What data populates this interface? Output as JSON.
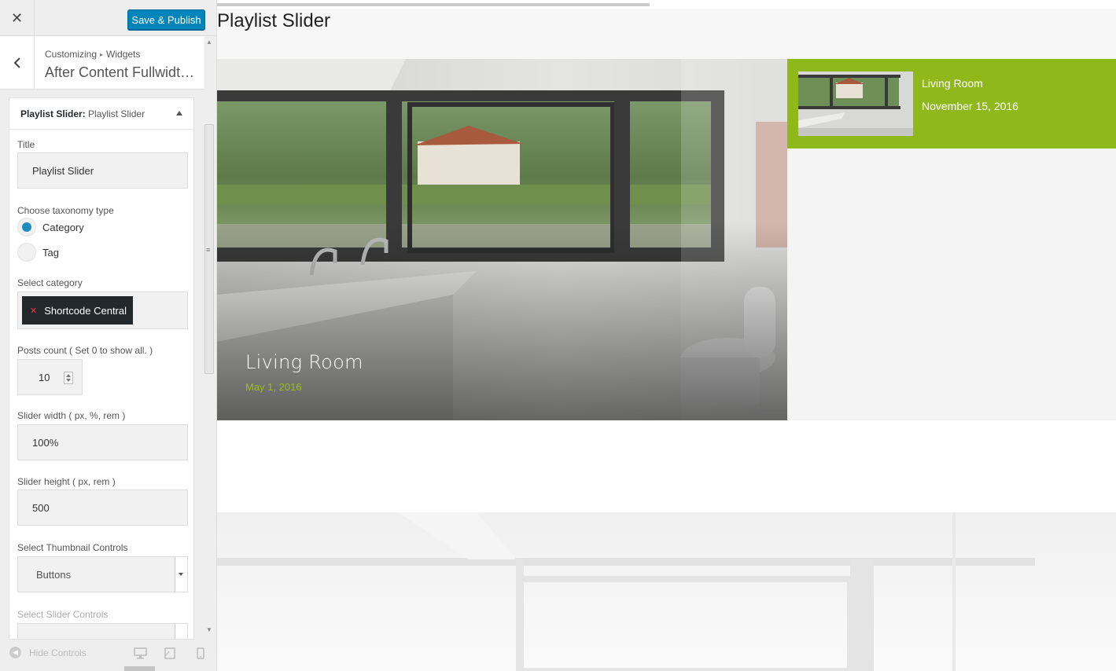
{
  "topbar": {
    "close_icon": "close-icon",
    "publish_label": "Save & Publish",
    "publish_color": "#0085ba"
  },
  "section": {
    "crumb_parent": "Customizing",
    "crumb_child": "Widgets",
    "title": "After Content Fullwidth..."
  },
  "widget": {
    "title_bold": "Playlist Slider:",
    "title_rest": " Playlist Slider",
    "title_label": "Title",
    "title_value": "Playlist Slider",
    "taxonomy_label": "Choose taxonomy type",
    "taxonomy_options": [
      "Category",
      "Tag"
    ],
    "taxonomy_selected": "Category",
    "category_label": "Select category",
    "category_tag": "Shortcode Central",
    "posts_count_label": "Posts count ( Set 0 to show all. )",
    "posts_count_value": "10",
    "slider_width_label": "Slider width ( px, %, rem )",
    "slider_width_value": "100%",
    "slider_height_label": "Slider height ( px, rem )",
    "slider_height_value": "500",
    "thumb_controls_label": "Select Thumbnail Controls",
    "thumb_controls_value": "Buttons",
    "slider_controls_label": "Select Slider Controls"
  },
  "footer": {
    "hide_controls": "Hide Controls",
    "devices": [
      "desktop-icon",
      "tablet-icon",
      "mobile-icon"
    ]
  },
  "preview": {
    "heading": "Playlist Slider",
    "main_slide": {
      "title": "Living Room",
      "date": "May 1, 2016"
    },
    "playlist": [
      {
        "title": "Living Room",
        "date": "November 15, 2016"
      }
    ],
    "accent_color": "#8fb81b",
    "date_color": "#9dbd1a"
  }
}
